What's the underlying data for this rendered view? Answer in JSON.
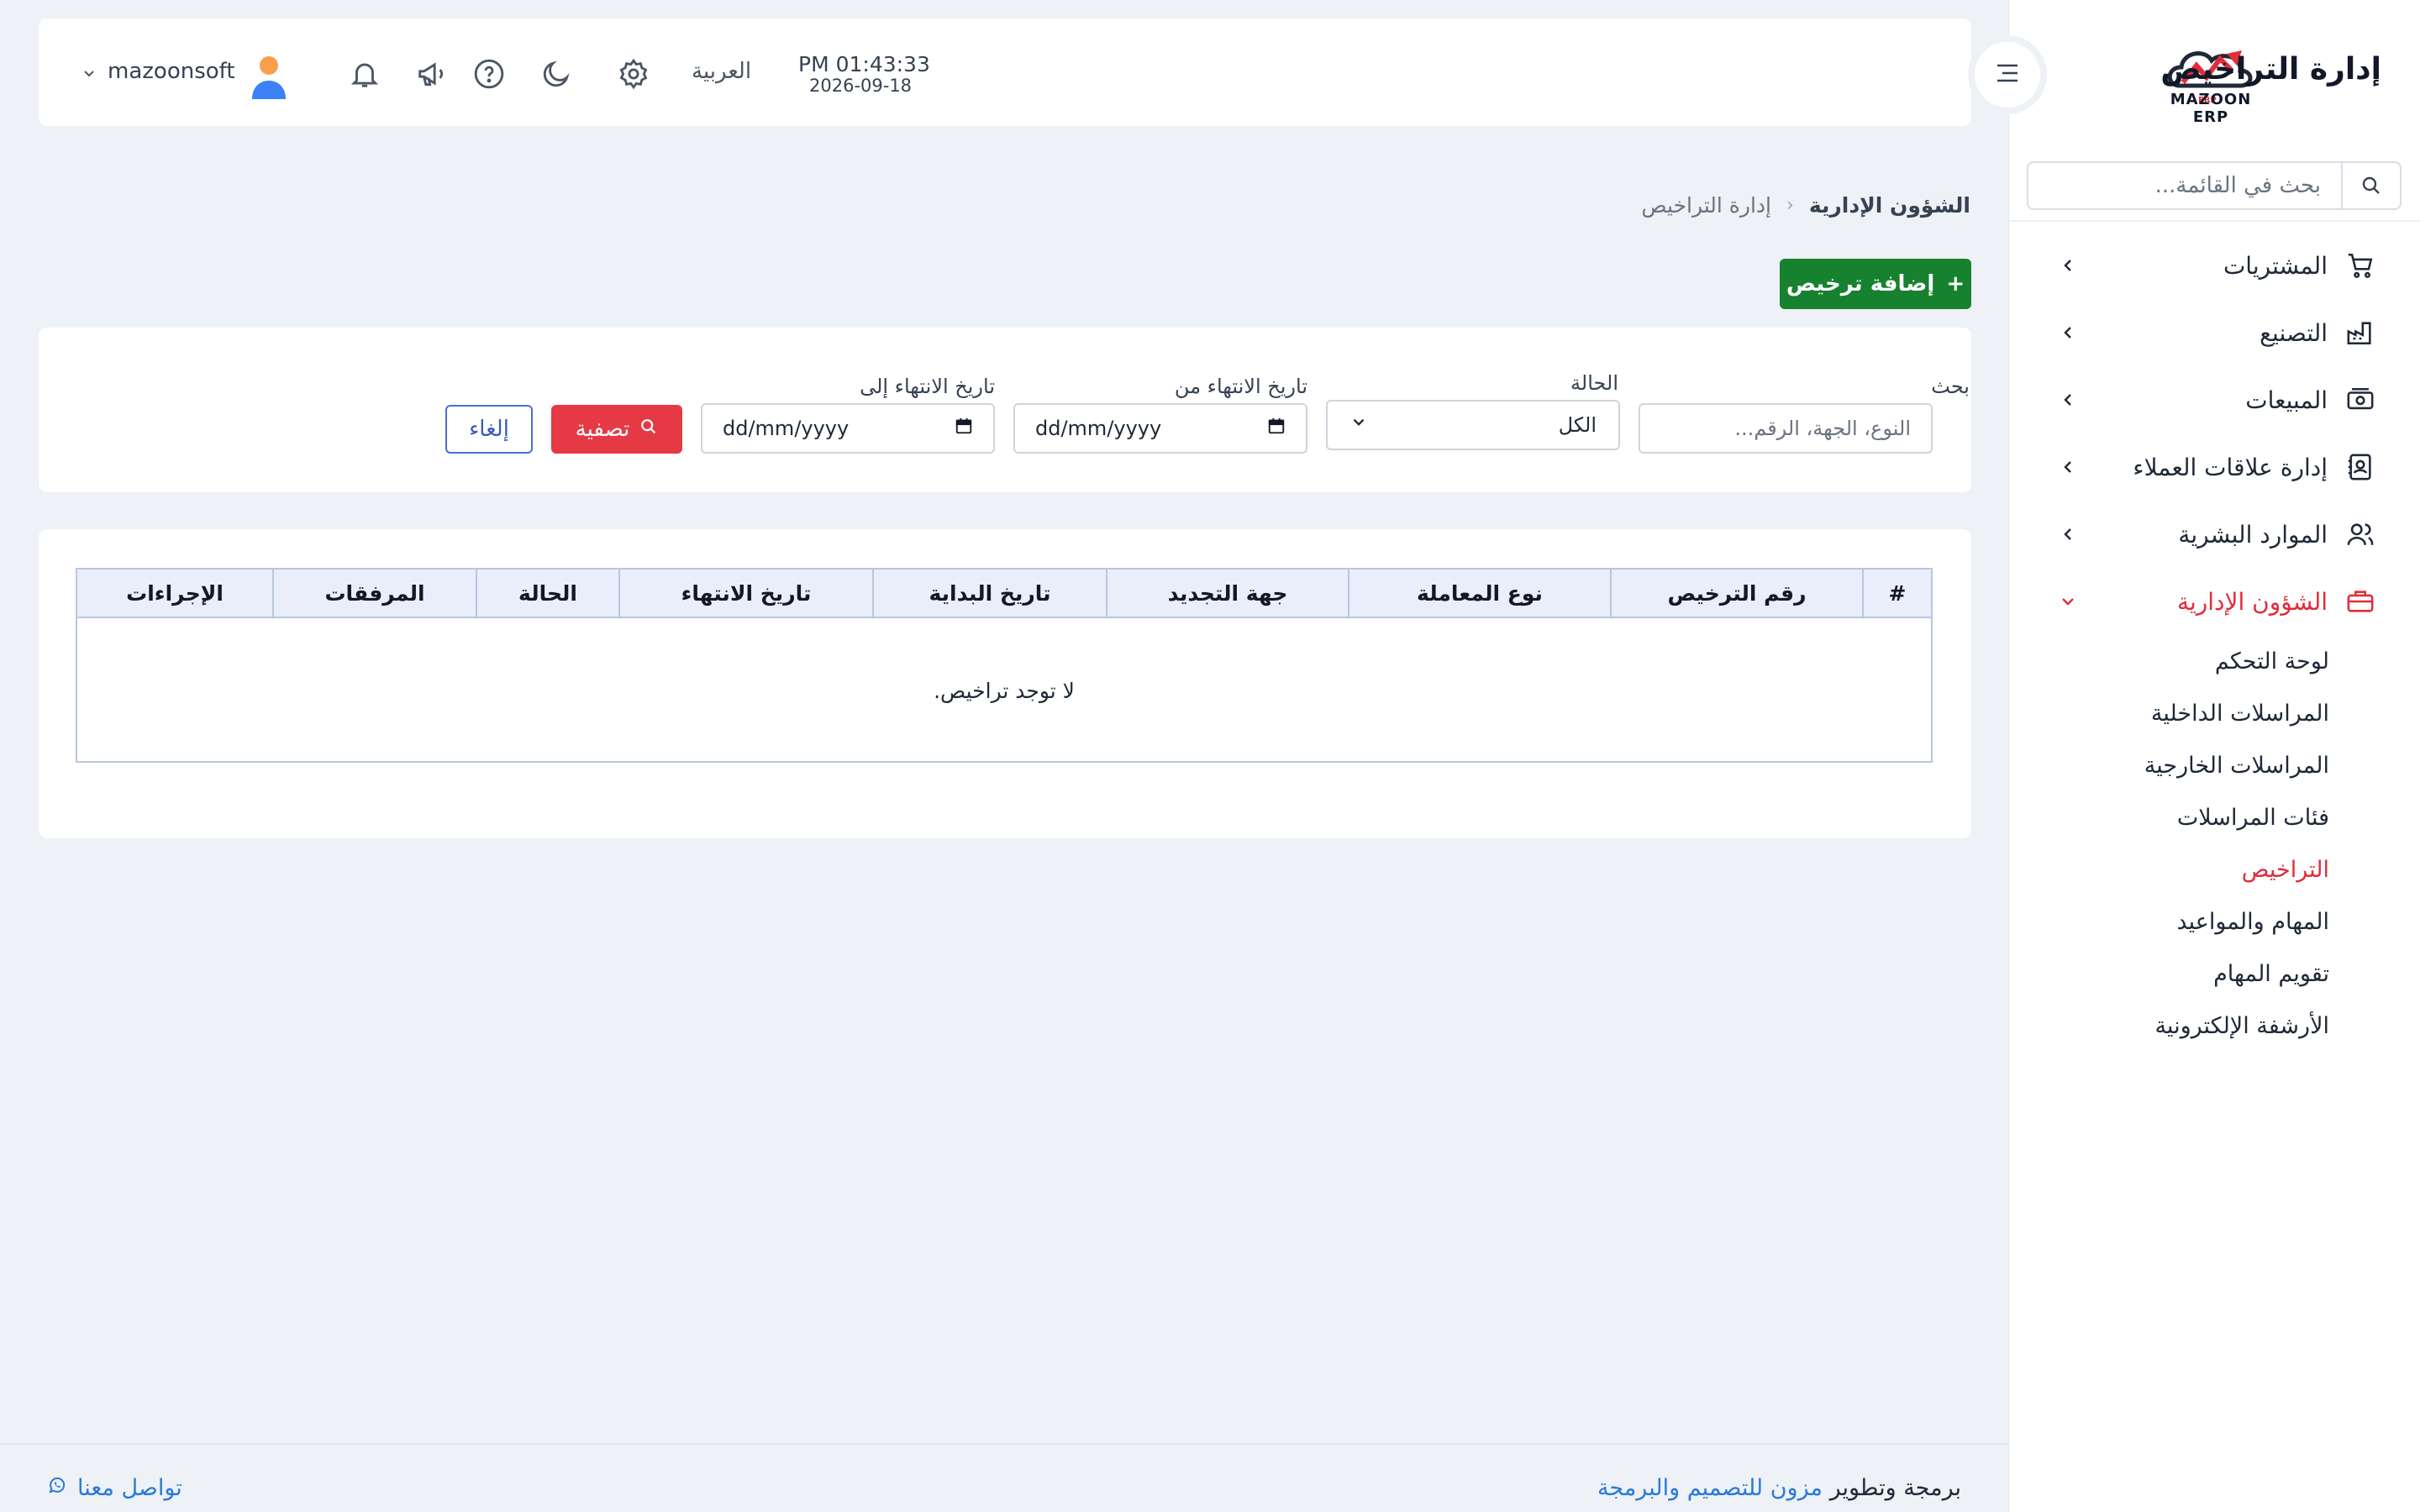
{
  "sidebar": {
    "logo_text": "MAZOON ERP",
    "search_placeholder": "بحث في القائمة...",
    "items": [
      {
        "label": "المشتريات",
        "icon": "cart-icon"
      },
      {
        "label": "التصنيع",
        "icon": "factory-icon"
      },
      {
        "label": "المبيعات",
        "icon": "cash-register-icon"
      },
      {
        "label": "إدارة علاقات العملاء",
        "icon": "address-book-icon"
      },
      {
        "label": "الموارد البشرية",
        "icon": "users-icon"
      },
      {
        "label": "الشؤون الإدارية",
        "icon": "briefcase-icon",
        "active": true
      }
    ],
    "subitems": [
      {
        "label": "لوحة التحكم"
      },
      {
        "label": "المراسلات الداخلية"
      },
      {
        "label": "المراسلات الخارجية"
      },
      {
        "label": "فئات المراسلات"
      },
      {
        "label": "التراخيص",
        "active": true
      },
      {
        "label": "المهام والمواعيد"
      },
      {
        "label": "تقويم المهام"
      },
      {
        "label": "الأرشفة الإلكترونية"
      }
    ]
  },
  "header": {
    "title": "إدارة التراخيص",
    "time": "PM 01:43:33",
    "date": "2026-09-18",
    "language": "العربية",
    "username": "mazoonsoft",
    "icons": [
      "settings-icon",
      "moon-icon",
      "help-icon",
      "megaphone-icon",
      "bell-icon"
    ]
  },
  "breadcrumb": {
    "parent": "الشؤون الإدارية",
    "separator": "‹",
    "current": "إدارة التراخيص"
  },
  "actions": {
    "add_label": "إضافة ترخيص",
    "add_prefix": "+"
  },
  "filters": {
    "search_label": "بحث",
    "search_placeholder": "النوع، الجهة، الرقم...",
    "status_label": "الحالة",
    "status_value": "الكل",
    "expiry_from_label": "تاريخ الانتهاء من",
    "expiry_from_value": "dd/mm/yyyy",
    "expiry_to_label": "تاريخ الانتهاء إلى",
    "expiry_to_value": "dd/mm/yyyy",
    "filter_button": "تصفية",
    "cancel_button": "إلغاء"
  },
  "table": {
    "columns": [
      "#",
      "رقم الترخيص",
      "نوع المعاملة",
      "جهة التجديد",
      "تاريخ البداية",
      "تاريخ الانتهاء",
      "الحالة",
      "المرفقات",
      "الإجراءات"
    ],
    "empty_message": "لا توجد تراخيص."
  },
  "footer": {
    "credit_prefix": "برمجة وتطوير",
    "credit_link": "مزون للتصميم والبرمجة",
    "contact_label": "تواصل معنا"
  },
  "colors": {
    "accent_red": "#e12c3c",
    "add_green": "#16812e",
    "filter_red": "#e63946",
    "link_blue": "#2a7ad8"
  }
}
